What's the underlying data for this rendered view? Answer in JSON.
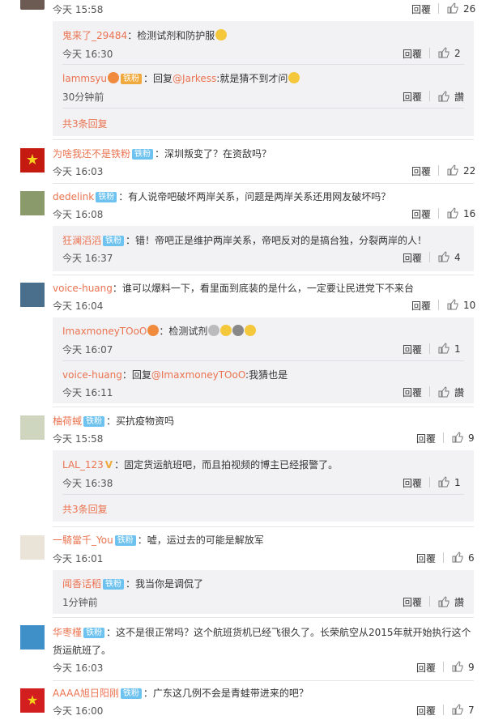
{
  "ui": {
    "reply": "回覆",
    "zan": "讚",
    "badge": "铁粉"
  },
  "c0": {
    "time": "今天 15:58",
    "likes": "26"
  },
  "c0s1": {
    "user": "鬼来了_29484",
    "text": "：检测试剂和防护服",
    "time": "今天 16:30",
    "likes": "2"
  },
  "c0s2": {
    "user": "lammsyu",
    "badge": "铁粉",
    "text": "：回复",
    "at": "@Jarkess",
    "text2": ":就是猜不到才问",
    "time": "30分钟前"
  },
  "c0more": "共3条回复",
  "c1": {
    "user": "为啥我还不是铁粉",
    "text": "：深圳叛变了？在资敌吗？",
    "time": "今天 16:03",
    "likes": "22"
  },
  "c2": {
    "user": "dedelink",
    "text": "：有人说帝吧破坏两岸关系，问题是两岸关系还用网友破坏吗？",
    "time": "今天 16:08",
    "likes": "16"
  },
  "c2s1": {
    "user": "狂澜滔滔",
    "text": "：错！帝吧正是维护两岸关系，帝吧反对的是搞台独，分裂两岸的人！",
    "time": "今天 16:37",
    "likes": "4"
  },
  "c3": {
    "user": "voice-huang",
    "text": "：谁可以爆料一下，看里面到底装的是什么，一定要让民进党下不来台",
    "time": "今天 16:04",
    "likes": "10"
  },
  "c3s1": {
    "user": "ImaxmoneyTOoO",
    "text": "：检测试剂",
    "time": "今天 16:07",
    "likes": "1"
  },
  "c3s2": {
    "user": "voice-huang",
    "text": "：回复",
    "at": "@ImaxmoneyTOoO",
    "text2": ":我猜也是",
    "time": "今天 16:11"
  },
  "c4": {
    "user": "柚荷蜮",
    "text": "：买抗疫物资吗",
    "time": "今天 15:58",
    "likes": "9"
  },
  "c4s1": {
    "user": "LAL_123",
    "text": "：固定货运航班吧，而且拍视频的博主已经报警了。",
    "time": "今天 16:38",
    "likes": "1"
  },
  "c4more": "共3条回复",
  "c5": {
    "user": "一騎當千_You",
    "text": "：嘘，运过去的可能是解放军",
    "time": "今天 16:01",
    "likes": "6"
  },
  "c5s1": {
    "user": "闻香话稻",
    "text": "：我当你是调侃了",
    "time": "1分钟前"
  },
  "c6": {
    "user": "华枣槿",
    "text": "：这不是很正常吗？这个航班货机已经飞很久了。长荣航空从2015年就开始执行这个",
    "text_cont": "货运航班了。",
    "time": "今天 16:03",
    "likes": "9"
  },
  "c7": {
    "user": "AAAA旭日阳刚",
    "text": "：广东这几例不会是青蛙带进来的吧？",
    "time": "今天 16:00",
    "likes": "7"
  }
}
